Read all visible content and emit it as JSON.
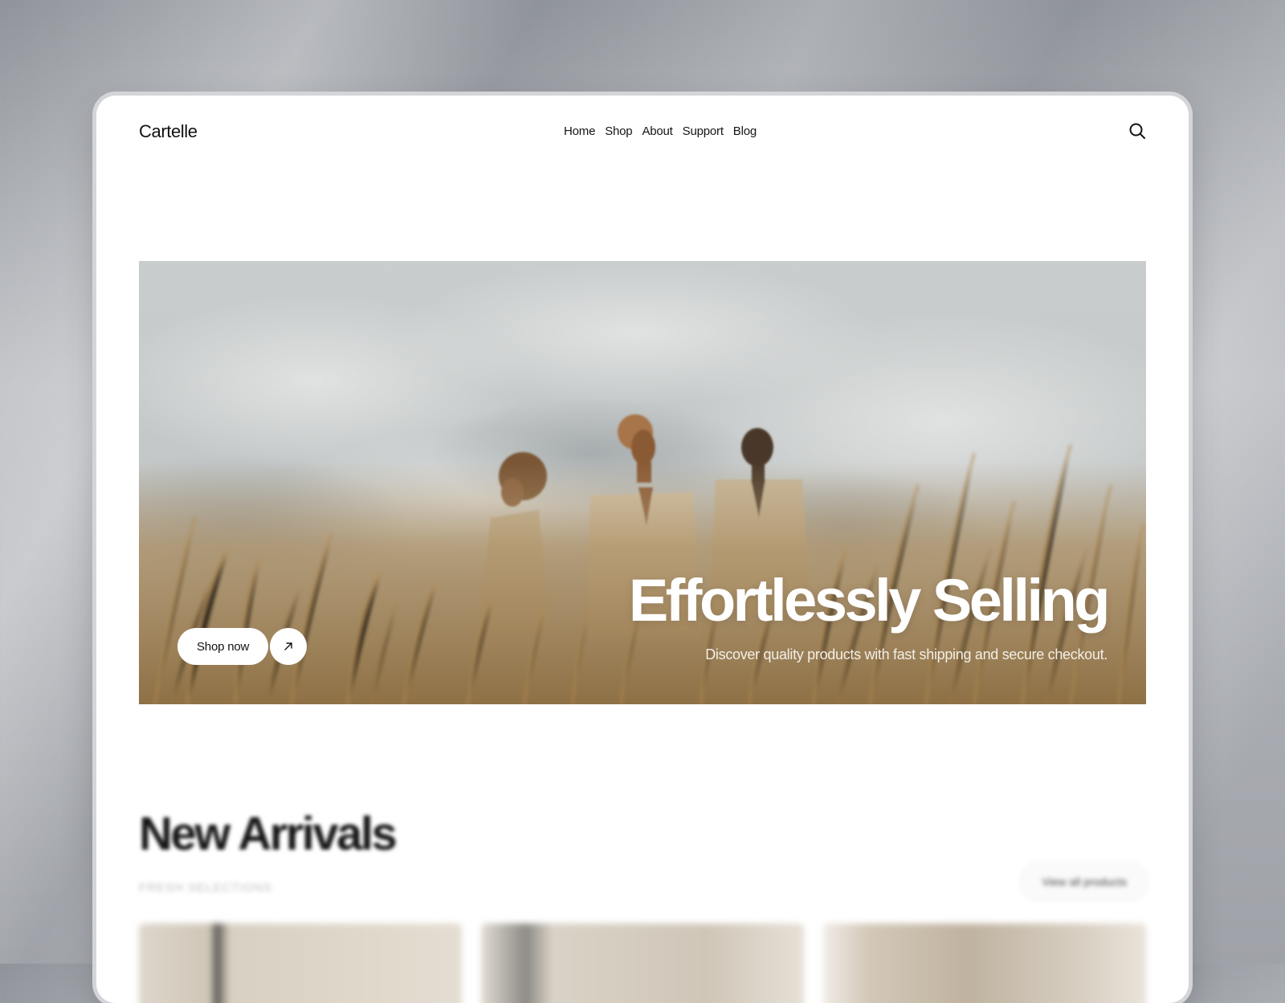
{
  "brand": {
    "name": "Cartelle"
  },
  "nav": {
    "items": [
      {
        "label": "Home"
      },
      {
        "label": "Shop"
      },
      {
        "label": "About"
      },
      {
        "label": "Support"
      },
      {
        "label": "Blog"
      }
    ],
    "search_icon": "search-icon"
  },
  "hero": {
    "title": "Effortlessly Selling",
    "subtitle": "Discover quality products with fast shipping and secure checkout.",
    "cta_label": "Shop now",
    "cta_icon": "arrow-up-right-icon"
  },
  "new_arrivals": {
    "title": "New Arrivals",
    "subtitle": "FRESH SELECTIONS",
    "view_all_label": "View all products"
  },
  "colors": {
    "text": "#111111",
    "background": "#ffffff",
    "hero_sky": "#c7cbcc",
    "hero_field": "#a88a5c",
    "suit": "#cdbfa6"
  }
}
